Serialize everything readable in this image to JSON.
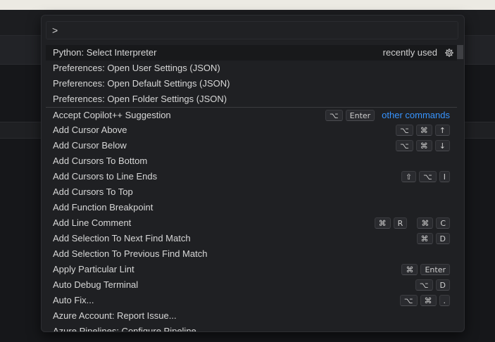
{
  "palette": {
    "input_value": ">",
    "recently_used_label": "recently used",
    "other_commands_label": "other commands",
    "items": [
      {
        "label": "Python: Select Interpreter",
        "keys": []
      },
      {
        "label": "Preferences: Open User Settings (JSON)",
        "keys": []
      },
      {
        "label": "Preferences: Open Default Settings (JSON)",
        "keys": []
      },
      {
        "label": "Preferences: Open Folder Settings (JSON)",
        "keys": []
      },
      {
        "label": "Accept Copilot++ Suggestion",
        "keys": [
          [
            "⌥",
            "Enter"
          ]
        ]
      },
      {
        "label": "Add Cursor Above",
        "keys": [
          [
            "⌥",
            "⌘",
            "↑"
          ]
        ]
      },
      {
        "label": "Add Cursor Below",
        "keys": [
          [
            "⌥",
            "⌘",
            "↓"
          ]
        ]
      },
      {
        "label": "Add Cursors To Bottom",
        "keys": []
      },
      {
        "label": "Add Cursors to Line Ends",
        "keys": [
          [
            "⇧",
            "⌥",
            "I"
          ]
        ]
      },
      {
        "label": "Add Cursors To Top",
        "keys": []
      },
      {
        "label": "Add Function Breakpoint",
        "keys": []
      },
      {
        "label": "Add Line Comment",
        "keys": [
          [
            "⌘",
            "R"
          ],
          [
            "⌘",
            "C"
          ]
        ]
      },
      {
        "label": "Add Selection To Next Find Match",
        "keys": [
          [
            "⌘",
            "D"
          ]
        ]
      },
      {
        "label": "Add Selection To Previous Find Match",
        "keys": []
      },
      {
        "label": "Apply Particular Lint",
        "keys": [
          [
            "⌘",
            "Enter"
          ]
        ]
      },
      {
        "label": "Auto Debug Terminal",
        "keys": [
          [
            "⌥",
            "D"
          ]
        ]
      },
      {
        "label": "Auto Fix...",
        "keys": [
          [
            "⌥",
            "⌘",
            "."
          ]
        ]
      },
      {
        "label": "Azure Account: Report Issue...",
        "keys": []
      },
      {
        "label": "Azure Pipelines: Configure Pipeline",
        "keys": []
      }
    ]
  },
  "icons": {
    "settings": "gear-icon"
  },
  "colors": {
    "background": "#1f2023",
    "selected_row": "#18191b",
    "link": "#3794ff",
    "text": "#d7d7d7"
  }
}
